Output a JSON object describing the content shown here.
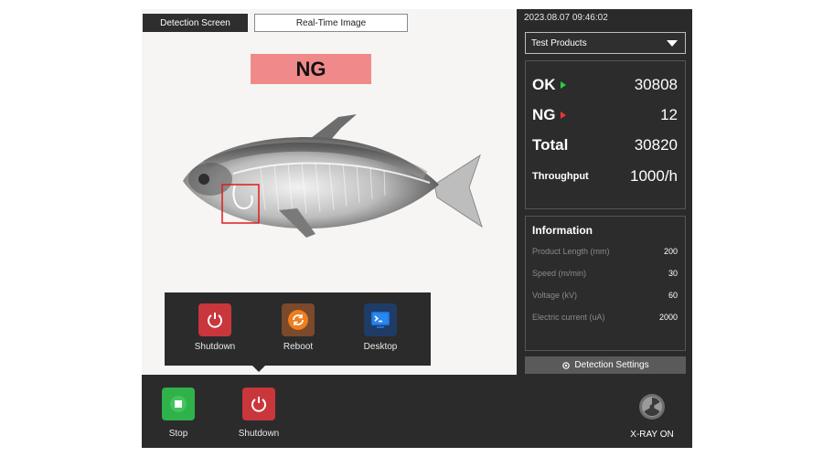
{
  "tabs": {
    "detection": "Detection Screen",
    "realtime": "Real-Time Image"
  },
  "result_banner": "NG",
  "power_menu": {
    "shutdown": "Shutdown",
    "reboot": "Reboot",
    "desktop": "Desktop"
  },
  "side": {
    "datetime": "2023.08.07  09:46:02",
    "product": "Test Products",
    "counts": {
      "ok_label": "OK",
      "ok_value": "30808",
      "ng_label": "NG",
      "ng_value": "12",
      "total_label": "Total",
      "total_value": "30820",
      "throughput_label": "Throughput",
      "throughput_value": "1000/h"
    },
    "info": {
      "title": "Information",
      "rows": [
        {
          "label": "Product Length (mm)",
          "value": "200"
        },
        {
          "label": "Speed (m/min)",
          "value": "30"
        },
        {
          "label": "Voltage (kV)",
          "value": "60"
        },
        {
          "label": "Electric current (uA)",
          "value": "2000"
        }
      ]
    },
    "settings_button": "Detection Settings"
  },
  "bottom": {
    "stop": "Stop",
    "shutdown": "Shutdown",
    "xray_status": "X-RAY ON"
  },
  "colors": {
    "ng_banner": "#f08a8a",
    "ok_indicator": "#2ecc40",
    "ng_indicator": "#e53935",
    "stop_green": "#2fb24a",
    "shutdown_red": "#c9363c",
    "reboot_orange": "#ef7d22",
    "desktop_blue": "#1e6fd0"
  },
  "icons": {
    "shutdown": "power-icon",
    "reboot": "refresh-icon",
    "desktop": "terminal-icon",
    "stop": "stop-icon",
    "settings": "gear-icon",
    "xray": "radiation-icon"
  }
}
